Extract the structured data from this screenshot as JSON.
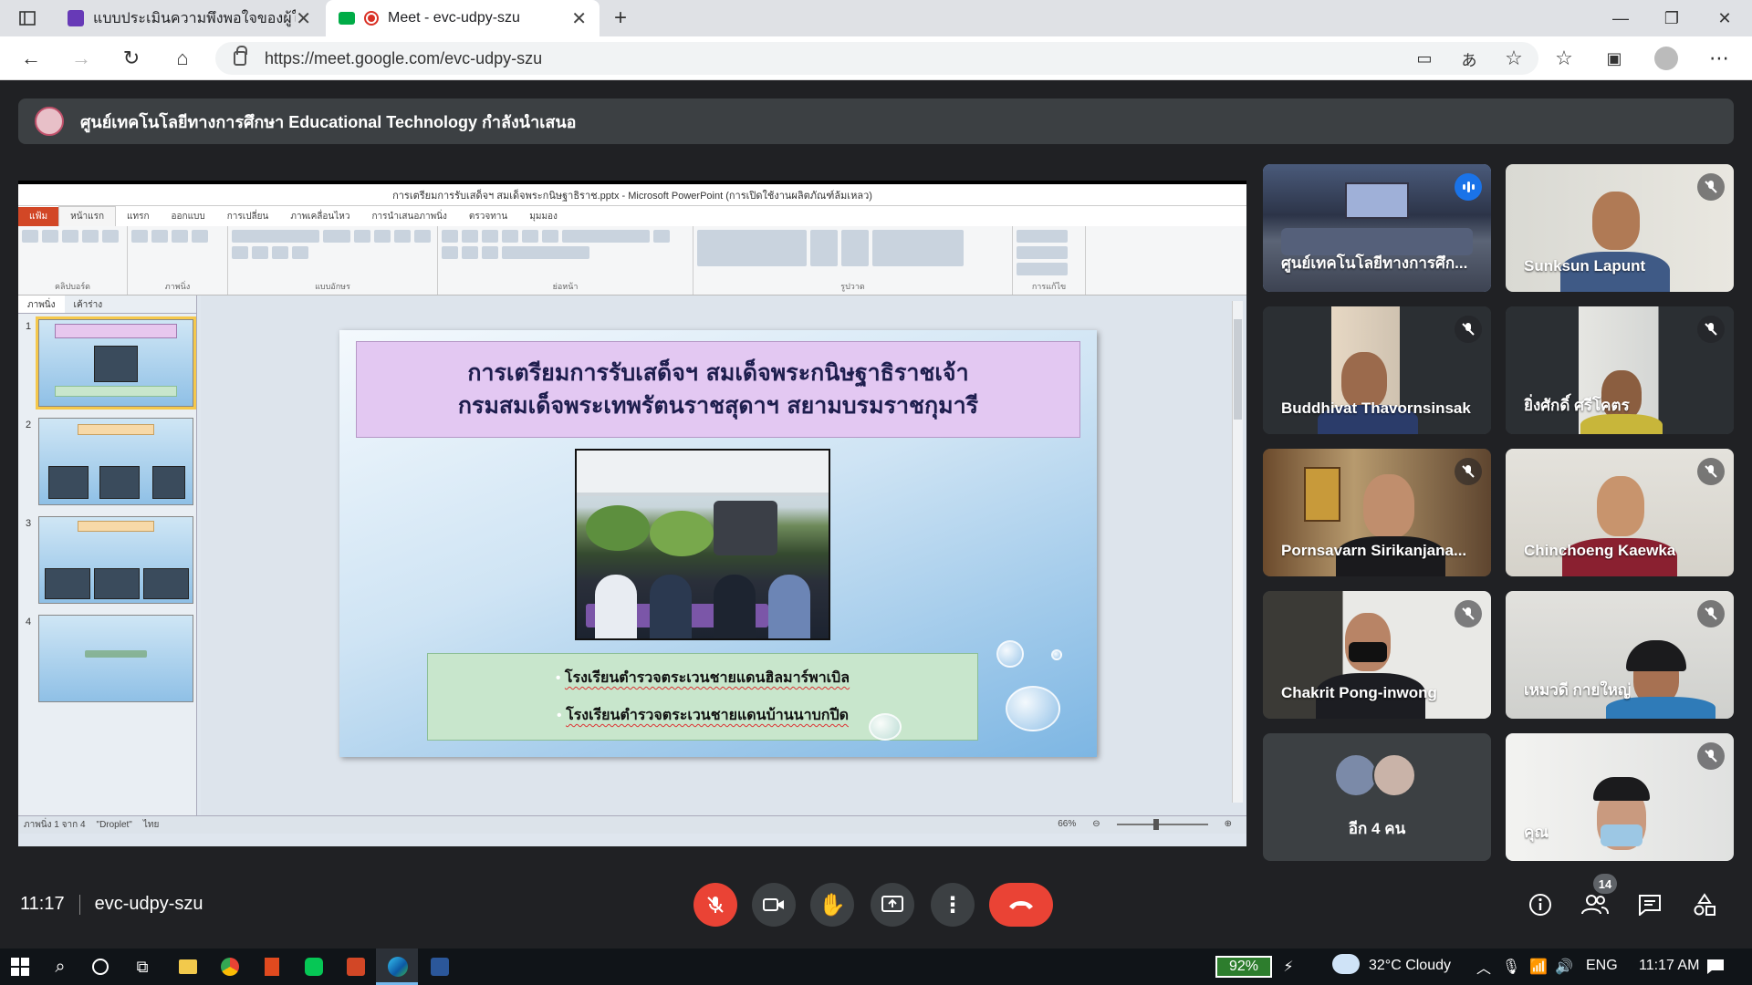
{
  "browser": {
    "tabs": [
      {
        "title": "แบบประเมินความพึงพอใจของผู้ใช้งาน",
        "active": false
      },
      {
        "title": "Meet - evc-udpy-szu",
        "active": true
      }
    ],
    "url": "https://meet.google.com/evc-udpy-szu"
  },
  "meet": {
    "presenting_banner": "ศูนย์เทคโนโลยีทางการศึกษา Educational Technology กำลังนำเสนอ",
    "time": "11:17",
    "meeting_code": "evc-udpy-szu",
    "participant_count": "14",
    "colors": {
      "end_call": "#ea4335",
      "active_speaker": "#8ab4f8",
      "background": "#202124"
    },
    "participants": [
      {
        "name": "ศูนย์เทคโนโลยีทางการศึก...",
        "speaking": true
      },
      {
        "name": "Sunksun Lapunt",
        "muted": true
      },
      {
        "name": "Buddhivat Thavornsinsak",
        "muted": true
      },
      {
        "name": "ยิ่งศักดิ์ ศรีโคตร",
        "muted": true
      },
      {
        "name": "Pornsavarn Sirikanjana...",
        "muted": true
      },
      {
        "name": "Chinchoeng Kaewka",
        "muted": true
      },
      {
        "name": "Chakrit Pong-inwong",
        "muted": true
      },
      {
        "name": "เหมวดี กายใหญ่",
        "muted": true
      },
      {
        "name": "อีก 4 คน"
      },
      {
        "name": "คุณ",
        "muted": true
      }
    ]
  },
  "ppt": {
    "window_title": "การเตรียมการรับเสด็จฯ สมเด็จพระกนิษฐาธิราช.pptx - Microsoft PowerPoint (การเปิดใช้งานผลิตภัณฑ์ล้มเหลว)",
    "ribbon_tabs": [
      "แฟ้ม",
      "หน้าแรก",
      "แทรก",
      "ออกแบบ",
      "การเปลี่ยน",
      "ภาพเคลื่อนไหว",
      "การนำเสนอภาพนิ่ง",
      "ตรวจทาน",
      "มุมมอง"
    ],
    "ribbon_groups": [
      "คลิปบอร์ด",
      "ภาพนิ่ง",
      "แบบอักษร",
      "ย่อหน้า",
      "รูปวาด",
      "การแก้ไข"
    ],
    "panel_tabs": [
      "ภาพนิ่ง",
      "เค้าร่าง"
    ],
    "slide_numbers": [
      "1",
      "2",
      "3",
      "4"
    ],
    "status": {
      "slide": "ภาพนิ่ง 1 จาก 4",
      "theme": "\"Droplet\"",
      "language": "ไทย",
      "zoom": "66%"
    },
    "slide": {
      "title_line1": "การเตรียมการรับเสด็จฯ สมเด็จพระกนิษฐาธิราชเจ้า",
      "title_line2": "กรมสมเด็จพระเทพรัตนราชสุดาฯ สยามบรมราชกุมารี",
      "bullets": [
        "โรงเรียนตำรวจตระเวนชายแดนฮิลมาร์พาเบิล",
        "โรงเรียนตำรวจตระเวนชายแดนบ้านนาบกปีด"
      ]
    }
  },
  "taskbar": {
    "battery": "92%",
    "weather": "32°C  Cloudy",
    "language": "ENG",
    "clock": "11:17 AM"
  }
}
